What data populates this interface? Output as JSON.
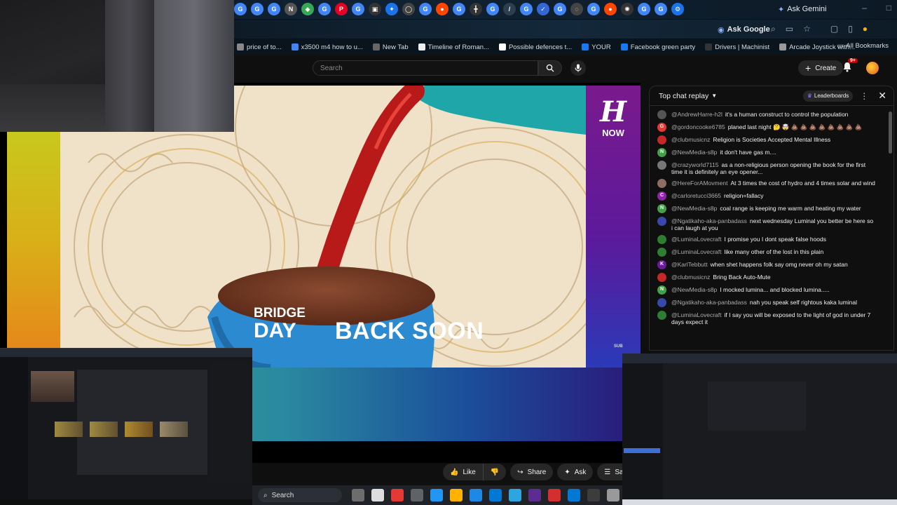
{
  "browser": {
    "tab_favicons": [
      {
        "icon": "chrome-icon",
        "color": "#4285f4",
        "glyph": "G"
      },
      {
        "icon": "chrome-icon",
        "color": "#4285f4",
        "glyph": "G"
      },
      {
        "icon": "chrome-icon",
        "color": "#4285f4",
        "glyph": "G"
      },
      {
        "icon": "news-icon",
        "color": "#555555",
        "glyph": "N"
      },
      {
        "icon": "maps-icon",
        "color": "#34a853",
        "glyph": "◆"
      },
      {
        "icon": "chrome-icon",
        "color": "#4285f4",
        "glyph": "G"
      },
      {
        "icon": "pinterest-icon",
        "color": "#e60023",
        "glyph": "P"
      },
      {
        "icon": "chrome-icon",
        "color": "#4285f4",
        "glyph": "G"
      },
      {
        "icon": "game-icon",
        "color": "#333333",
        "glyph": "▣"
      },
      {
        "icon": "app-icon",
        "color": "#1a73e8",
        "glyph": "✦"
      },
      {
        "icon": "github-icon",
        "color": "#444444",
        "glyph": "◯"
      },
      {
        "icon": "chrome-icon",
        "color": "#4285f4",
        "glyph": "G"
      },
      {
        "icon": "reddit-icon",
        "color": "#ff4500",
        "glyph": "●"
      },
      {
        "icon": "chrome-icon",
        "color": "#4285f4",
        "glyph": "G"
      },
      {
        "icon": "app-icon",
        "color": "#333333",
        "glyph": "╋"
      },
      {
        "icon": "chrome-icon",
        "color": "#4285f4",
        "glyph": "G"
      },
      {
        "icon": "tool-icon",
        "color": "#2d3e50",
        "glyph": "/"
      },
      {
        "icon": "chrome-icon",
        "color": "#4285f4",
        "glyph": "G"
      },
      {
        "icon": "check-icon",
        "color": "#3367d6",
        "glyph": "✓"
      },
      {
        "icon": "chrome-icon",
        "color": "#4285f4",
        "glyph": "G"
      },
      {
        "icon": "app-icon",
        "color": "#444444",
        "glyph": "◌"
      },
      {
        "icon": "chrome-icon",
        "color": "#4285f4",
        "glyph": "G"
      },
      {
        "icon": "reddit-icon",
        "color": "#ff4500",
        "glyph": "●"
      },
      {
        "icon": "settings-icon",
        "color": "#333333",
        "glyph": "✺"
      },
      {
        "icon": "chrome-icon",
        "color": "#4285f4",
        "glyph": "G"
      },
      {
        "icon": "chrome-icon",
        "color": "#4285f4",
        "glyph": "G"
      },
      {
        "icon": "gear-icon",
        "color": "#1a73e8",
        "glyph": "⚙"
      }
    ],
    "ask_gemini_label": "Ask Gemini",
    "ask_google_label": "Ask Google",
    "bookmarks": [
      {
        "label": "price of to...",
        "color": "#888888"
      },
      {
        "label": "x3500 m4 how to u...",
        "color": "#4285f4"
      },
      {
        "label": "New Tab",
        "color": "#666666"
      },
      {
        "label": "Timeline of Roman...",
        "color": "#eeeeee"
      },
      {
        "label": "Possible defences t...",
        "color": "#ffffff"
      },
      {
        "label": "YOUR",
        "color": "#1877f2"
      },
      {
        "label": "Facebook green party",
        "color": "#1877f2"
      },
      {
        "label": "Drivers | Machinist",
        "color": "#333333"
      },
      {
        "label": "Arcade Joystick with...",
        "color": "#999999"
      }
    ],
    "all_bookmarks_label": "All Bookmarks"
  },
  "youtube": {
    "search_placeholder": "Search",
    "create_label": "Create",
    "notification_count": "9+",
    "video": {
      "banner_title_line1": "BRIDGE",
      "banner_title_line2": "DAY",
      "banner_status": "BACK SOON",
      "banner_sub": "SUB",
      "side_logo_letter": "H",
      "side_logo_word": "NOW"
    },
    "actions": {
      "like_label": "Like",
      "share_label": "Share",
      "ask_label": "Ask",
      "save_label": "Save"
    }
  },
  "chat": {
    "title": "Top chat replay",
    "leaderboards_label": "Leaderboards",
    "messages": [
      {
        "author": "@AndrewHarre-h2l",
        "text": "it's a human construct to control the population",
        "avatar_letter": "",
        "avatar_color": "#555555"
      },
      {
        "author": "@gordoncooke6785",
        "text": "planed last night 🤔 🤯 💩 💩 💩 💩 💩 💩 💩 💩",
        "avatar_letter": "G",
        "avatar_color": "#e53935"
      },
      {
        "author": "@clubmusicnz",
        "text": "Religion is Societies Accepted Mental Illness",
        "avatar_letter": "",
        "avatar_color": "#c62828"
      },
      {
        "author": "@NewMedia-s8p",
        "text": "it don't have gas m....",
        "avatar_letter": "N",
        "avatar_color": "#43a047"
      },
      {
        "author": "@crazyworld7115",
        "text": "as a non-religious person opening the book for the first time it is definitely an eye opener...",
        "avatar_letter": "",
        "avatar_color": "#777777"
      },
      {
        "author": "@HereForAMovment",
        "text": "At 3 times the cost of hydro and 4 times solar and wind",
        "avatar_letter": "",
        "avatar_color": "#8d6e63"
      },
      {
        "author": "@carloretucci3665",
        "text": "religion=fallacy",
        "avatar_letter": "C",
        "avatar_color": "#8e24aa"
      },
      {
        "author": "@NewMedia-s8p",
        "text": "coal range is keeping me warm and heating my water",
        "avatar_letter": "N",
        "avatar_color": "#43a047"
      },
      {
        "author": "@Ngatikaho-aka-panbadass",
        "text": "next wednesday Luminal you better be here so i can laugh at you",
        "avatar_letter": "",
        "avatar_color": "#3949ab"
      },
      {
        "author": "@LuminaLovecraft",
        "text": "I promise you I dont speak false hoods",
        "avatar_letter": "",
        "avatar_color": "#2e7d32"
      },
      {
        "author": "@LuminaLovecraft",
        "text": "like many other of the lost in this plain",
        "avatar_letter": "",
        "avatar_color": "#2e7d32"
      },
      {
        "author": "@KarlTebbutt",
        "text": "when shet happens folk say omg never oh my satan",
        "avatar_letter": "K",
        "avatar_color": "#6a1b9a"
      },
      {
        "author": "@clubmusicnz",
        "text": "Bring Back Auto-Mute",
        "avatar_letter": "",
        "avatar_color": "#c62828"
      },
      {
        "author": "@NewMedia-s8p",
        "text": "I mocked lumina... and blocked lumina.....",
        "avatar_letter": "N",
        "avatar_color": "#43a047"
      },
      {
        "author": "@Ngatikaho-aka-panbadass",
        "text": "nah you speak self rightous kaka luminal",
        "avatar_letter": "",
        "avatar_color": "#3949ab"
      },
      {
        "author": "@LuminaLovecraft",
        "text": "if I say you will be exposed to the light of god in under 7 days expect it",
        "avatar_letter": "",
        "avatar_color": "#2e7d32"
      }
    ]
  },
  "taskbar": {
    "search_label": "Search",
    "apps": [
      "#6d6d6d",
      "#dddddd",
      "#e53935",
      "#5f6368",
      "#2196f3",
      "#ffb300",
      "#1e88e5",
      "#0078d4",
      "#2ca5e0",
      "#5c2d91",
      "#d32f2f",
      "#0078d4",
      "#3c3c3c",
      "#999999"
    ]
  }
}
